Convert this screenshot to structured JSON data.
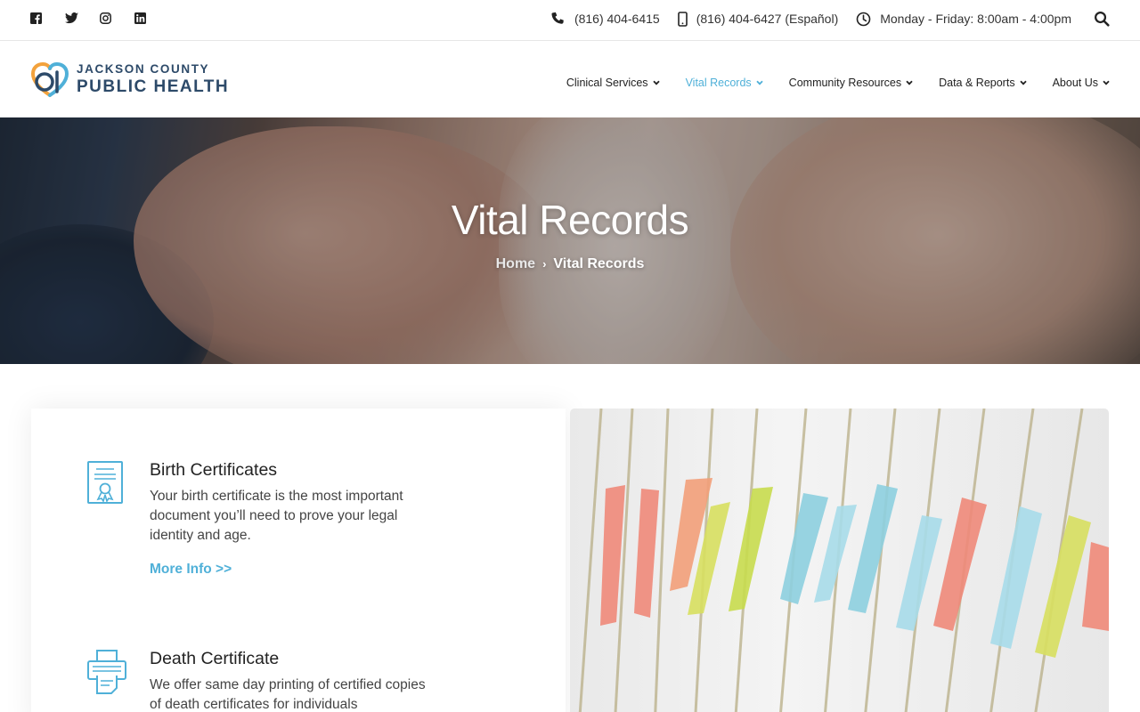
{
  "topbar": {
    "social": [
      "facebook-icon",
      "twitter-icon",
      "instagram-icon",
      "linkedin-icon"
    ],
    "phone": "(816) 404-6415",
    "mobile": "(816) 404-6427 (Español)",
    "hours": "Monday - Friday: 8:00am - 4:00pm"
  },
  "logo": {
    "line1": "JACKSON COUNTY",
    "line2": "PUBLIC HEALTH"
  },
  "nav": {
    "items": [
      {
        "label": "Clinical Services"
      },
      {
        "label": "Vital Records"
      },
      {
        "label": "Community Resources"
      },
      {
        "label": "Data & Reports"
      },
      {
        "label": "About Us"
      }
    ],
    "active": "Vital Records"
  },
  "hero": {
    "title": "Vital Records",
    "breadcrumb_home": "Home",
    "breadcrumb_separator": "›",
    "breadcrumb_current": "Vital Records"
  },
  "services": [
    {
      "title": "Birth Certificates",
      "description": "Your birth certificate is the most important document you’ll need to prove your legal identity and age.",
      "link": "More Info >>",
      "icon": "certificate-icon"
    },
    {
      "title": "Death Certificate",
      "description": "We offer same day printing of certified copies of death certificates for individuals",
      "icon": "printer-icon"
    }
  ],
  "colors": {
    "accent": "#4fb0d8",
    "brand_navy": "#2d4a69",
    "text": "#222222"
  }
}
